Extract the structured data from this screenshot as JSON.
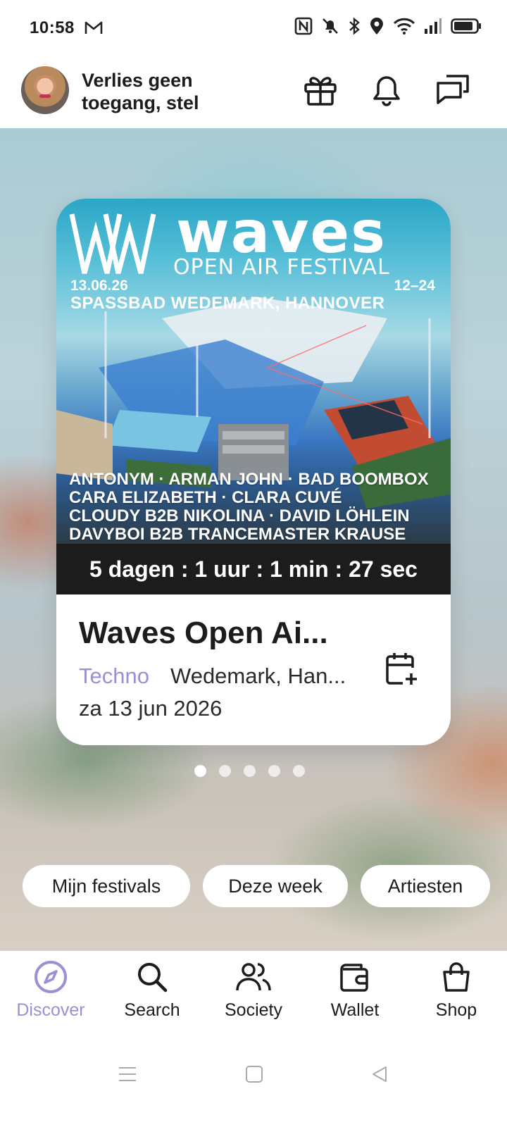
{
  "status_bar": {
    "time": "10:58",
    "icons": [
      "gmail-icon",
      "nfc-icon",
      "mute-icon",
      "bluetooth-icon",
      "location-icon",
      "wifi-icon",
      "signal-icon",
      "battery-icon"
    ]
  },
  "header": {
    "prompt_text": "Verlies geen toegang, stel",
    "icons": [
      "gift-icon",
      "bell-icon",
      "messages-icon"
    ]
  },
  "featured": {
    "poster": {
      "title": "waves",
      "subtitle": "OPEN AIR FESTIVAL",
      "date": "13.06.26",
      "hours": "12–24",
      "venue": "SPASSBAD WEDEMARK, HANNOVER",
      "lineup": [
        "ANTONYM · ARMAN JOHN · BAD BOOMBOX",
        "CARA ELIZABETH  ·  CLARA CUVÉ",
        "CLOUDY B2B NIKOLINA  ·  DAVID LÖHLEIN",
        "DAVYBOI B2B TRANCEMASTER KRAUSE"
      ]
    },
    "countdown": "5 dagen : 1 uur : 1 min : 27 sec",
    "event_title": "Waves Open Ai...",
    "genre": "Techno",
    "location": "Wedemark, Han...",
    "date": "za 13 jun 2026",
    "genre_color": "#9d8fd4"
  },
  "pager": {
    "count": 5,
    "active": 0
  },
  "chips": [
    "Mijn festivals",
    "Deze week",
    "Artiesten"
  ],
  "bottom_nav": [
    {
      "label": "Discover",
      "icon": "compass-icon",
      "active": true
    },
    {
      "label": "Search",
      "icon": "search-icon",
      "active": false
    },
    {
      "label": "Society",
      "icon": "users-icon",
      "active": false
    },
    {
      "label": "Wallet",
      "icon": "wallet-icon",
      "active": false
    },
    {
      "label": "Shop",
      "icon": "shopping-bag-icon",
      "active": false
    }
  ],
  "system_nav": [
    "menu-icon",
    "home-icon",
    "back-icon"
  ],
  "colors": {
    "accent": "#9d8fd4",
    "countdown_bg": "#1c1c1c"
  }
}
